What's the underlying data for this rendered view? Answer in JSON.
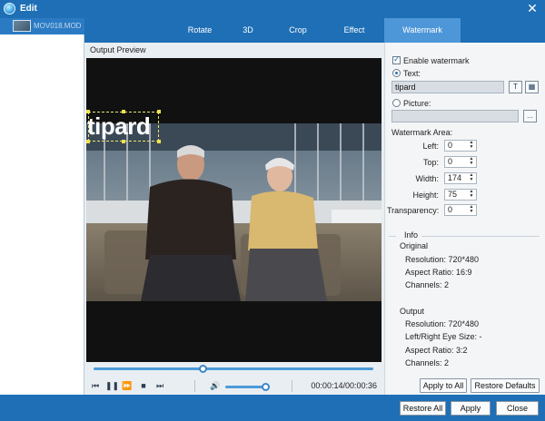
{
  "window": {
    "title": "Edit",
    "close_glyph": "✕"
  },
  "files": [
    {
      "name": "MOV018.MOD"
    }
  ],
  "tabs": [
    {
      "label": "Rotate",
      "active": false
    },
    {
      "label": "3D",
      "active": false
    },
    {
      "label": "Crop",
      "active": false
    },
    {
      "label": "Effect",
      "active": false
    },
    {
      "label": "Watermark",
      "active": true
    }
  ],
  "preview": {
    "label": "Output Preview",
    "watermark_text": "tipard",
    "seek_fraction": 0.39,
    "volume_fraction": 1.0,
    "time": "00:00:14/00:00:36"
  },
  "watermark": {
    "enable_label": "Enable watermark",
    "enabled": true,
    "text_label": "Text:",
    "text_selected": true,
    "text_value": "tipard",
    "picture_label": "Picture:",
    "picture_selected": false,
    "picture_value": "",
    "browse_label": "...",
    "area_label": "Watermark Area:",
    "left_label": "Left:",
    "left_value": "0",
    "top_label": "Top:",
    "top_value": "0",
    "width_label": "Width:",
    "width_value": "174",
    "height_label": "Height:",
    "height_value": "75",
    "transparency_label": "Transparency:",
    "transparency_value": "0"
  },
  "info": {
    "title": "Info",
    "original_label": "Original",
    "original": {
      "resolution": "Resolution: 720*480",
      "aspect": "Aspect Ratio: 16:9",
      "channels": "Channels: 2"
    },
    "output_label": "Output",
    "output": {
      "resolution": "Resolution: 720*480",
      "eye_size": "Left/Right Eye Size: -",
      "aspect": "Aspect Ratio: 3:2",
      "channels": "Channels: 2"
    }
  },
  "buttons": {
    "apply_to_all": "Apply to All",
    "restore_defaults": "Restore Defaults",
    "restore_all": "Restore All",
    "apply": "Apply",
    "close": "Close"
  },
  "colors": {
    "chrome": "#1e6fb5",
    "active_tab": "#4d97d8",
    "accent": "#4c9bd8"
  }
}
